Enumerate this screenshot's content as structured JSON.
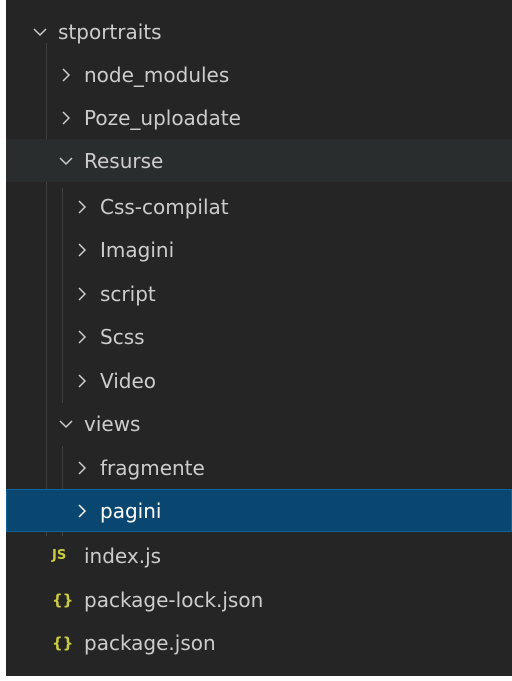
{
  "explorer": {
    "root": {
      "label": "stportraits",
      "state": "expanded"
    },
    "items": [
      {
        "label": "node_modules",
        "state": "collapsed"
      },
      {
        "label": "Poze_uploadate",
        "state": "collapsed"
      },
      {
        "label": "Resurse",
        "state": "expanded"
      },
      {
        "label": "Css-compilat",
        "state": "collapsed"
      },
      {
        "label": "Imagini",
        "state": "collapsed"
      },
      {
        "label": "script",
        "state": "collapsed"
      },
      {
        "label": "Scss",
        "state": "collapsed"
      },
      {
        "label": "Video",
        "state": "collapsed"
      },
      {
        "label": "views",
        "state": "expanded"
      },
      {
        "label": "fragmente",
        "state": "collapsed"
      },
      {
        "label": "pagini",
        "state": "collapsed",
        "selected": true
      },
      {
        "label": "index.js",
        "icon": "JS",
        "icon_name": "javascript-file-icon"
      },
      {
        "label": "package-lock.json",
        "icon": "{}",
        "icon_name": "json-file-icon"
      },
      {
        "label": "package.json",
        "icon": "{}",
        "icon_name": "json-file-icon"
      }
    ]
  },
  "colors": {
    "background": "#252526",
    "text": "#cccccc",
    "selected_background": "#094771",
    "hover_band": "#2a2d2e",
    "json_icon": "#cbcb41",
    "js_icon": "#cbcb41"
  }
}
